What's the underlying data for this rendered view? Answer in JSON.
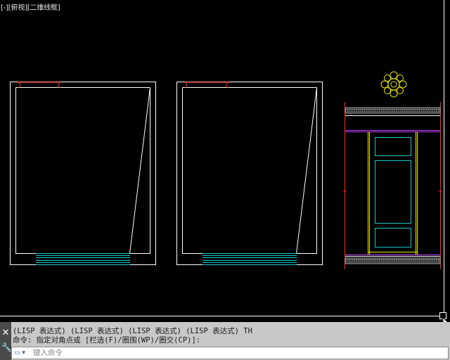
{
  "viewport": {
    "label": "[-][俯视][二维线框]"
  },
  "colors": {
    "background": "#000000",
    "white_line": "#ffffff",
    "cyan_line": "#19c8c8",
    "red_line": "#ff2a1a",
    "yellow_line": "#e6e600",
    "magenta_line": "#c040ff",
    "grey_hatch": "#a0a0a0"
  },
  "icons": {
    "close": "✕",
    "wrench": "🔧",
    "prompt": "▭ ▾"
  },
  "command_line": {
    "history": [
      "(LISP 表达式) (LISP 表达式) (LISP 表达式) (LISP 表达式) TH",
      "命令: 指定对角点或 [栏选(F)/圈围(WP)/圈交(CP)]:"
    ],
    "placeholder": "键入命令",
    "value": ""
  }
}
